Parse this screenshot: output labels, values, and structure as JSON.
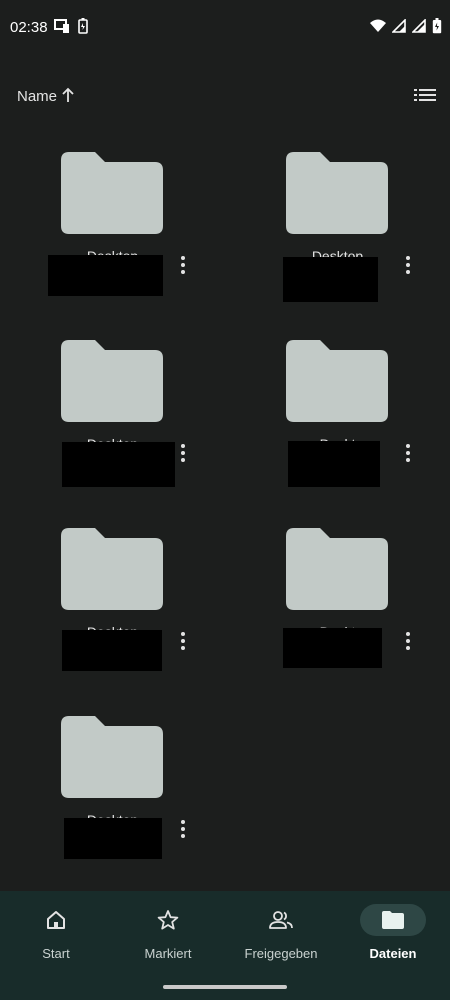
{
  "status_bar": {
    "time": "02:38",
    "left_icons": [
      "screen-cast-icon",
      "battery-saver-icon"
    ],
    "right_icons": [
      "wifi-icon",
      "cell-signal-icon",
      "cell-signal-2-icon",
      "battery-icon"
    ]
  },
  "sort": {
    "label": "Name",
    "direction_icon": "arrow-up-icon",
    "view_icon": "list-view-icon"
  },
  "folders": [
    {
      "name": "Desktop"
    },
    {
      "name": "Desktop"
    },
    {
      "name": "Desktop"
    },
    {
      "name": "Deskt"
    },
    {
      "name": "Desktop"
    },
    {
      "name": "Deskt"
    },
    {
      "name": "Desktop"
    }
  ],
  "bottom_nav": {
    "items": [
      {
        "label": "Start",
        "icon": "home-icon",
        "active": false
      },
      {
        "label": "Markiert",
        "icon": "star-icon",
        "active": false
      },
      {
        "label": "Freigegeben",
        "icon": "people-icon",
        "active": false
      },
      {
        "label": "Dateien",
        "icon": "folder-icon",
        "active": true
      }
    ]
  },
  "colors": {
    "background": "#1c1e1d",
    "folder": "#c2cac7",
    "nav_background": "#182c2a",
    "nav_active_pill": "#2e4745"
  }
}
